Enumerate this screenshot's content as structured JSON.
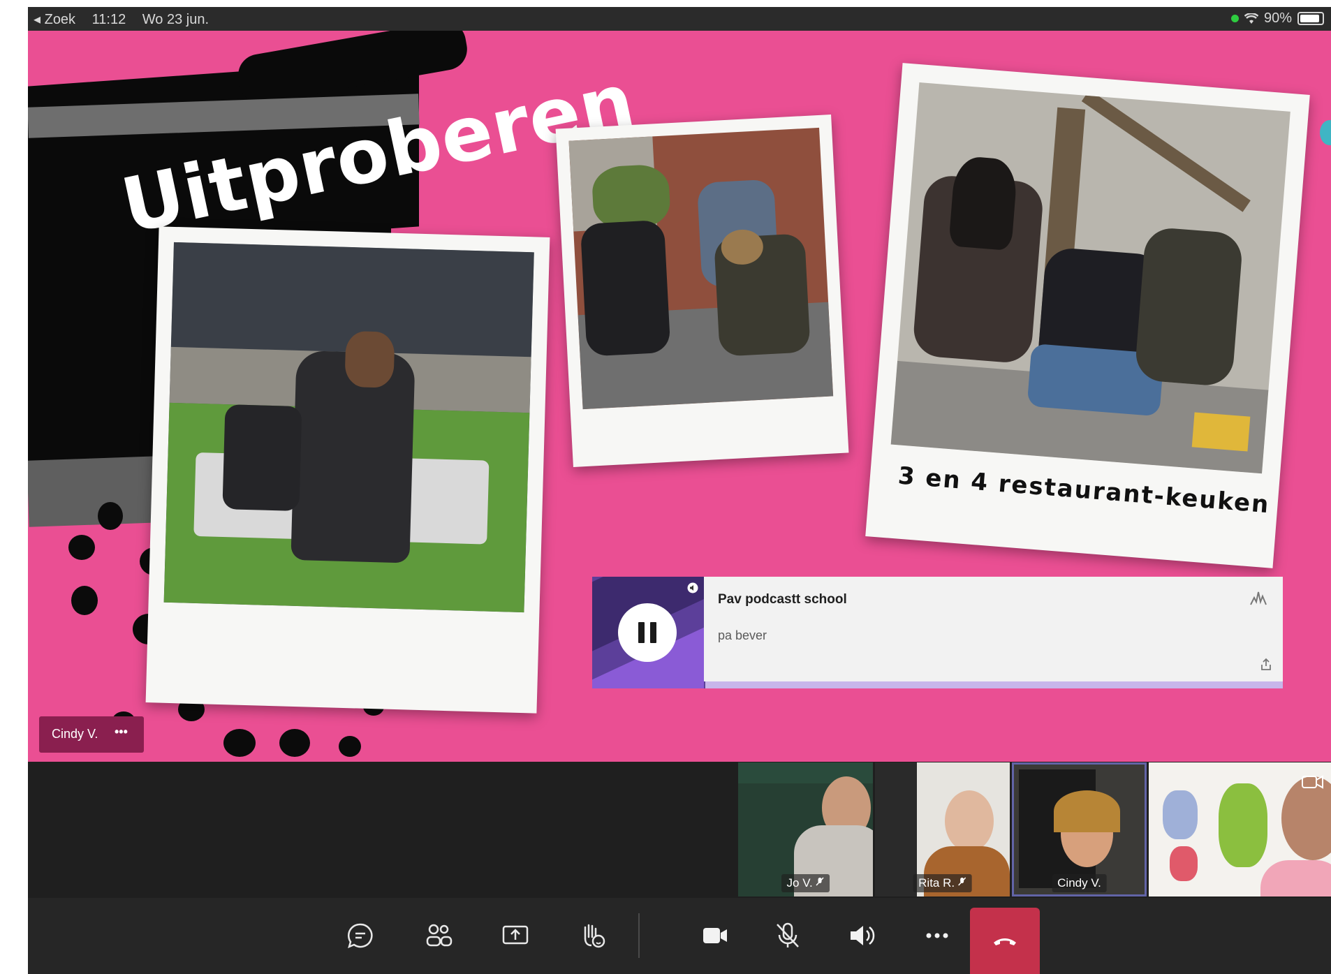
{
  "status_bar": {
    "back_label": "◂ Zoek",
    "time": "11:12",
    "date": "Wo 23 jun.",
    "battery": "90%"
  },
  "slide": {
    "title": "Uitproberen",
    "photo_caption": "3 en 4 restaurant-keuken",
    "presenter": "Cindy V.",
    "presenter_more": "•••"
  },
  "podcast": {
    "title": "Pav podcastt school",
    "author": "pa bever",
    "progress": 0
  },
  "participants": [
    {
      "name": "Jo V.",
      "muted": true
    },
    {
      "name": "Rita R.",
      "muted": true
    },
    {
      "name": "Cindy V.",
      "muted": false,
      "active": true
    },
    {
      "name": "",
      "self": true
    }
  ],
  "colors": {
    "slide_bg": "#ea4f93",
    "hangup": "#c4314b",
    "accent": "#6264a7",
    "podcast_purple": "#5c3f9a"
  },
  "toolbar": {
    "icons": [
      "chat-icon",
      "participants-icon",
      "share-screen-icon",
      "raise-hand-icon",
      "camera-icon",
      "mic-off-icon",
      "speaker-icon",
      "more-icon",
      "hang-up-icon"
    ]
  }
}
